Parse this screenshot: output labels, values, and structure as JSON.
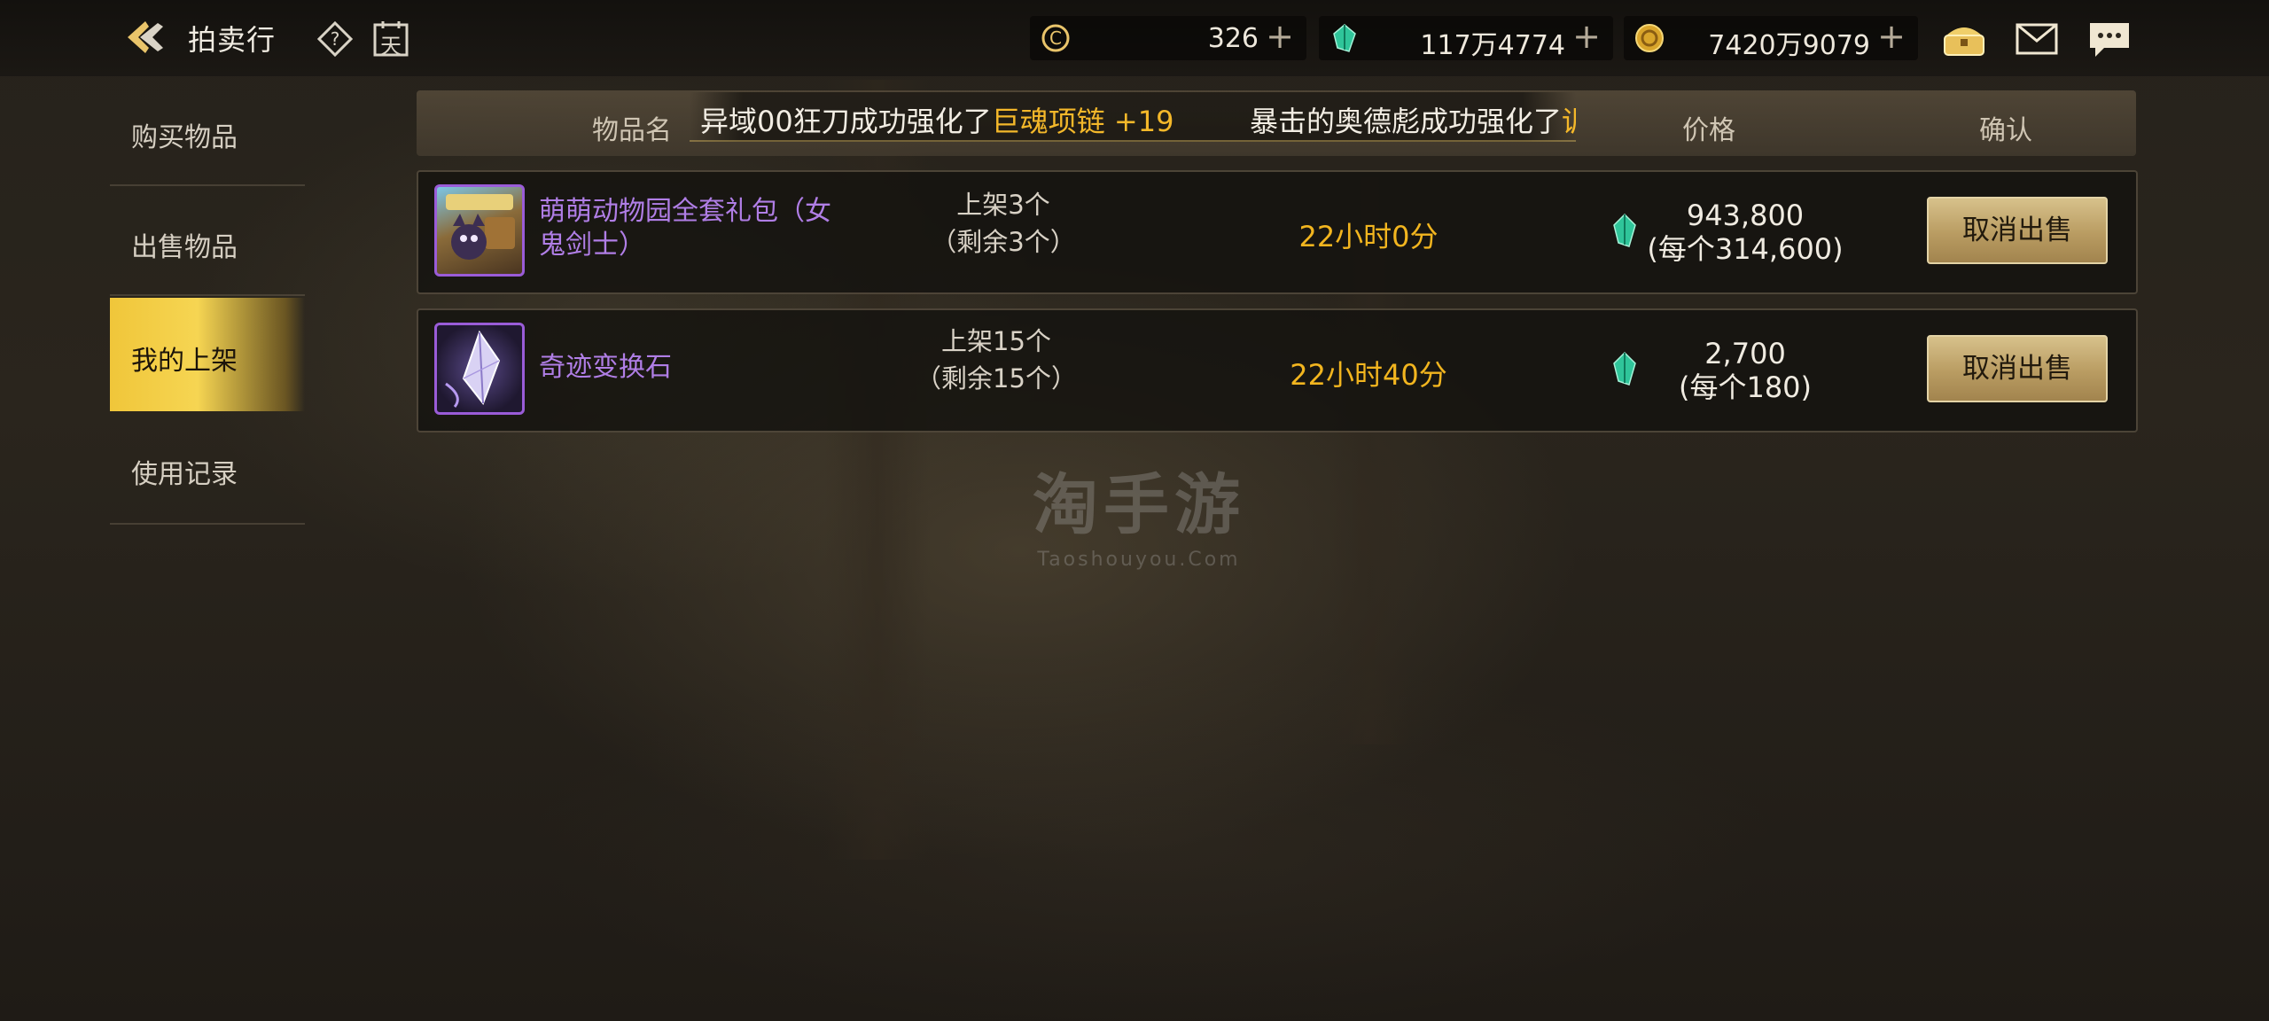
{
  "header": {
    "title": "拍卖行",
    "help_icon": "question-diamond-icon",
    "calendar_icon": "calendar-day-icon",
    "calendar_text": "天"
  },
  "currencies": [
    {
      "icon": "c-coin-icon",
      "value": "326",
      "plus": "+"
    },
    {
      "icon": "green-gem-icon",
      "value": "117万4774",
      "plus": "+"
    },
    {
      "icon": "gold-coin-icon",
      "value": "7420万9079",
      "plus": "+"
    }
  ],
  "top_icons": [
    "treasure-chest-icon",
    "mail-icon",
    "chat-icon"
  ],
  "sidebar": {
    "items": [
      {
        "label": "购买物品",
        "active": false
      },
      {
        "label": "出售物品",
        "active": false
      },
      {
        "label": "我的上架",
        "active": true
      },
      {
        "label": "使用记录",
        "active": false
      }
    ]
  },
  "table": {
    "headers": {
      "name": "物品名",
      "price": "价格",
      "confirm": "确认"
    },
    "ticker": {
      "msg1_pre": "异域00狂刀成功强化了",
      "msg1_item": "巨魂项链 +19",
      "msg2_pre": "暴击的奥德彪成功强化了",
      "msg2_item": "训"
    },
    "rows": [
      {
        "name": "萌萌动物园全套礼包（女鬼剑士）",
        "name_line1": "萌萌动物园全套礼包（女",
        "name_line2": "鬼剑士）",
        "listed": "上架3个",
        "remaining": "（剩余3个）",
        "time_left": "22小时0分",
        "price_total": "943,800",
        "price_each": "(每个314,600)",
        "button": "取消出售"
      },
      {
        "name": "奇迹变换石",
        "listed": "上架15个",
        "remaining": "（剩余15个）",
        "time_left": "22小时40分",
        "price_total": "2,700",
        "price_each": "(每个180)",
        "button": "取消出售"
      }
    ]
  },
  "watermark": {
    "big": "淘手游",
    "small": "Taoshouyou.Com"
  },
  "colors": {
    "accent_gold": "#f2b51f",
    "item_purple": "#b07ee6",
    "active_tab": "#f6d552"
  }
}
